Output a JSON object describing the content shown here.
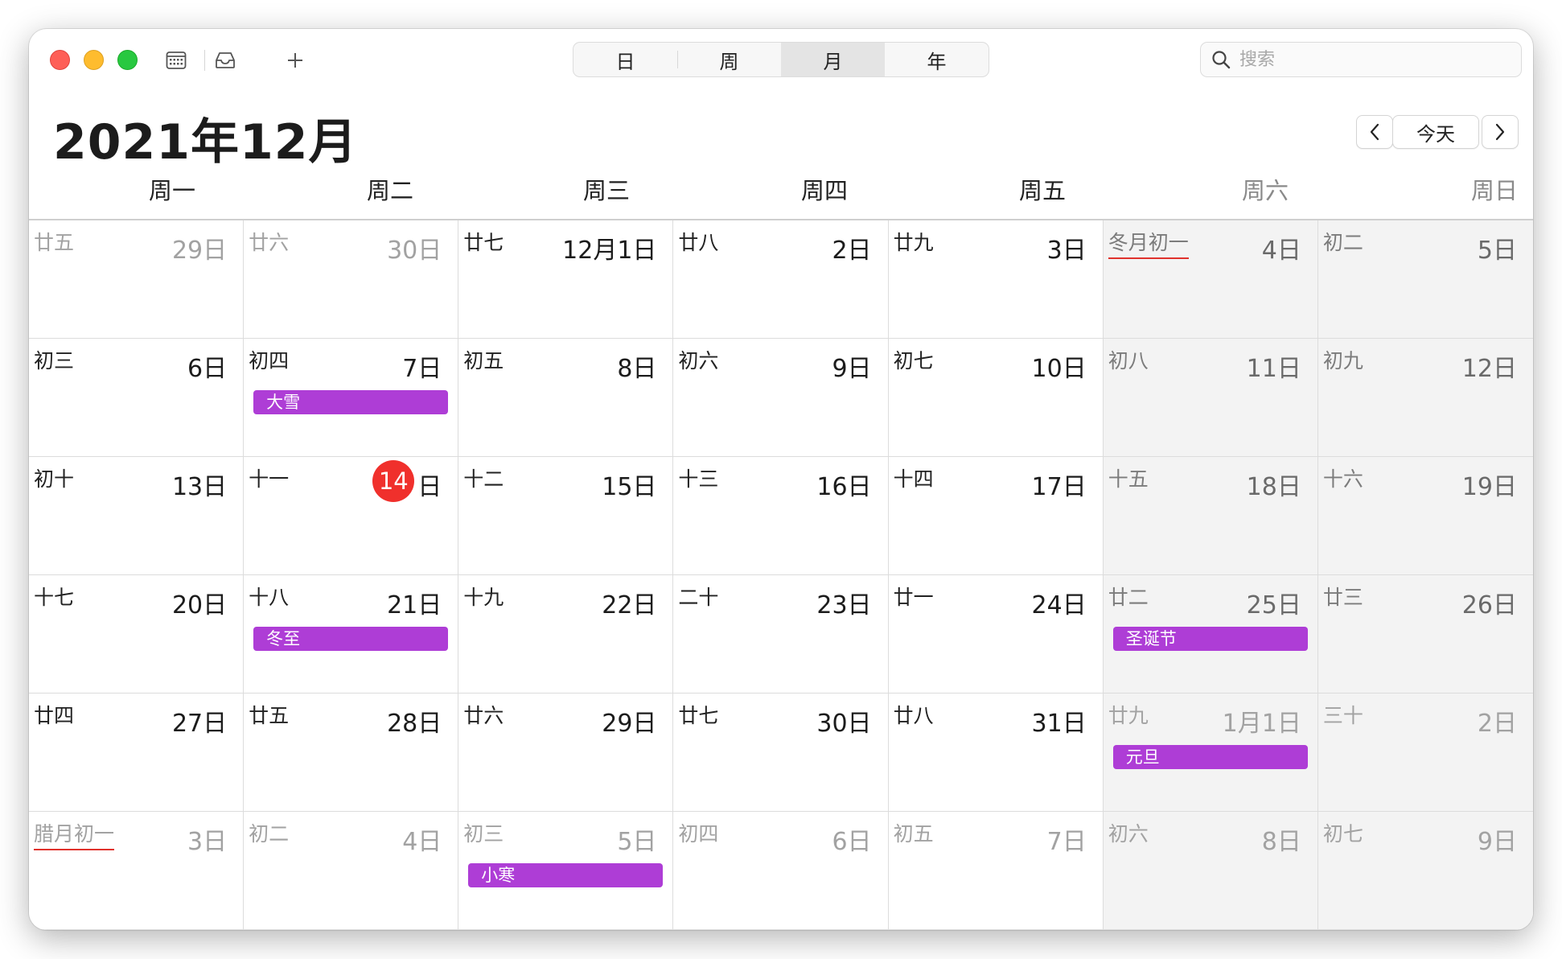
{
  "toolbar": {
    "view_modes": [
      "日",
      "周",
      "月",
      "年"
    ],
    "active_view": "月",
    "search_placeholder": "搜索"
  },
  "header": {
    "month_title": "2021年12月",
    "today_label": "今天"
  },
  "weekdays": [
    "周一",
    "周二",
    "周三",
    "周四",
    "周五",
    "周六",
    "周日"
  ],
  "weeks": [
    [
      {
        "lunar": "廿五",
        "day": "29日",
        "muted": true
      },
      {
        "lunar": "廿六",
        "day": "30日",
        "muted": true
      },
      {
        "lunar": "廿七",
        "day": "12月1日"
      },
      {
        "lunar": "廿八",
        "day": "2日"
      },
      {
        "lunar": "廿九",
        "day": "3日"
      },
      {
        "lunar": "冬月初一",
        "day": "4日",
        "lunar_month_start": true
      },
      {
        "lunar": "初二",
        "day": "5日"
      }
    ],
    [
      {
        "lunar": "初三",
        "day": "6日"
      },
      {
        "lunar": "初四",
        "day": "7日",
        "event": "大雪"
      },
      {
        "lunar": "初五",
        "day": "8日"
      },
      {
        "lunar": "初六",
        "day": "9日"
      },
      {
        "lunar": "初七",
        "day": "10日"
      },
      {
        "lunar": "初八",
        "day": "11日"
      },
      {
        "lunar": "初九",
        "day": "12日"
      }
    ],
    [
      {
        "lunar": "初十",
        "day": "13日"
      },
      {
        "lunar": "十一",
        "day": "14",
        "day_suffix": "日",
        "today": true
      },
      {
        "lunar": "十二",
        "day": "15日"
      },
      {
        "lunar": "十三",
        "day": "16日"
      },
      {
        "lunar": "十四",
        "day": "17日"
      },
      {
        "lunar": "十五",
        "day": "18日"
      },
      {
        "lunar": "十六",
        "day": "19日"
      }
    ],
    [
      {
        "lunar": "十七",
        "day": "20日"
      },
      {
        "lunar": "十八",
        "day": "21日",
        "event": "冬至"
      },
      {
        "lunar": "十九",
        "day": "22日"
      },
      {
        "lunar": "二十",
        "day": "23日"
      },
      {
        "lunar": "廿一",
        "day": "24日"
      },
      {
        "lunar": "廿二",
        "day": "25日",
        "event": "圣诞节"
      },
      {
        "lunar": "廿三",
        "day": "26日"
      }
    ],
    [
      {
        "lunar": "廿四",
        "day": "27日"
      },
      {
        "lunar": "廿五",
        "day": "28日"
      },
      {
        "lunar": "廿六",
        "day": "29日"
      },
      {
        "lunar": "廿七",
        "day": "30日"
      },
      {
        "lunar": "廿八",
        "day": "31日"
      },
      {
        "lunar": "廿九",
        "day": "1月1日",
        "muted": true,
        "event": "元旦"
      },
      {
        "lunar": "三十",
        "day": "2日",
        "muted": true
      }
    ],
    [
      {
        "lunar": "腊月初一",
        "day": "3日",
        "muted": true,
        "lunar_month_start": true
      },
      {
        "lunar": "初二",
        "day": "4日",
        "muted": true
      },
      {
        "lunar": "初三",
        "day": "5日",
        "muted": true,
        "event": "小寒"
      },
      {
        "lunar": "初四",
        "day": "6日",
        "muted": true
      },
      {
        "lunar": "初五",
        "day": "7日",
        "muted": true
      },
      {
        "lunar": "初六",
        "day": "8日",
        "muted": true
      },
      {
        "lunar": "初七",
        "day": "9日",
        "muted": true
      }
    ]
  ],
  "colors": {
    "event": "#ae3dd6",
    "today": "#f0302c",
    "lunar_month_marker": "#e0322c",
    "weekend_bg": "#f3f3f3"
  },
  "icons": [
    "calendar-list-icon",
    "inbox-icon",
    "plus-icon",
    "search-icon",
    "chevron-left-icon",
    "chevron-right-icon"
  ]
}
